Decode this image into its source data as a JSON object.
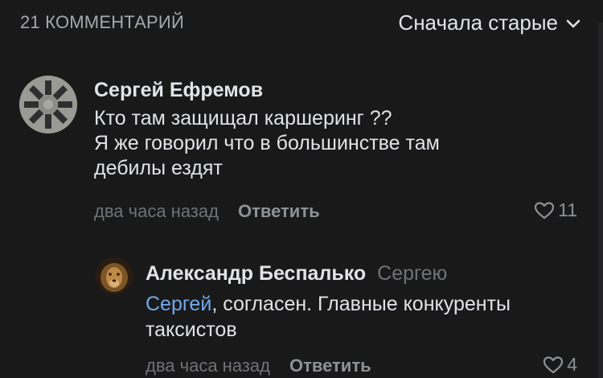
{
  "header": {
    "comments_count": "21 КОММЕНТАРИЙ",
    "sort_label": "Сначала старые",
    "sort_icon": "chevron-down-icon"
  },
  "comments": [
    {
      "author": "Сергей Ефремов",
      "text_lines": [
        "Кто там защищал каршеринг ??",
        "Я же говорил что в большинстве там",
        "дебилы ездят"
      ],
      "time": "два часа назад",
      "reply_label": "Ответить",
      "likes": "11",
      "like_icon": "heart-outline-icon"
    },
    {
      "author": "Александр Беспалько",
      "reply_to": "Сергею",
      "mention": "Сергей",
      "text_line1_rest": ", согласен. Главные конкуренты",
      "text_line2": "таксистов",
      "time": "два часа назад",
      "reply_label": "Ответить",
      "likes": "4",
      "like_icon": "heart-outline-icon"
    }
  ],
  "colors": {
    "background": "#19191a",
    "text_primary": "#e1e3e6",
    "text_secondary": "#6f7277",
    "accent_link": "#71aaeb"
  }
}
